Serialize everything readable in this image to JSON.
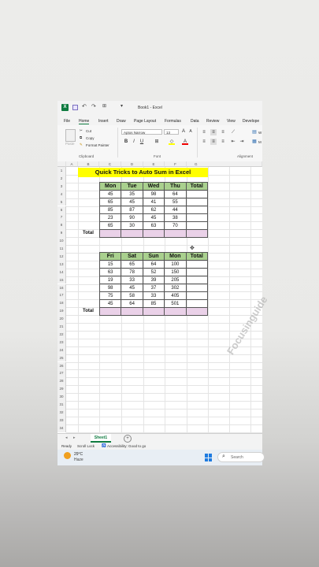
{
  "window": {
    "title": "Book1 - Excel",
    "undo_icon": "undo-icon",
    "redo_icon": "redo-icon",
    "save_icon": "save-icon"
  },
  "menu": [
    "File",
    "Home",
    "Insert",
    "Draw",
    "Page Layout",
    "Formulas",
    "Data",
    "Review",
    "View",
    "Develope"
  ],
  "ribbon": {
    "paste_label": "Paste",
    "cut_label": "Cut",
    "copy_label": "Copy",
    "format_painter_label": "Format Painter",
    "clipboard_group": "Clipboard",
    "font_name": "Aptos Narrow",
    "font_size": "13",
    "font_group": "Font",
    "alignment_group": "Alignment",
    "bold": "B",
    "italic": "I",
    "underline": "U",
    "wrap": "W",
    "merge": "M"
  },
  "columns": [
    "A",
    "B",
    "C",
    "D",
    "E",
    "F",
    "G"
  ],
  "rows": [
    "1",
    "2",
    "3",
    "4",
    "5",
    "6",
    "7",
    "8",
    "9",
    "10",
    "11",
    "12",
    "13",
    "14",
    "15",
    "16",
    "17",
    "18",
    "19",
    "20",
    "21",
    "22",
    "23",
    "24",
    "25",
    "26",
    "27",
    "28",
    "29",
    "30",
    "31",
    "32",
    "33",
    "34"
  ],
  "banner": "Quick Tricks to Auto Sum in Excel",
  "table1": {
    "headers": [
      "Mon",
      "Tue",
      "Wed",
      "Thu",
      "Total"
    ],
    "rows": [
      [
        "45",
        "35",
        "98",
        "64",
        ""
      ],
      [
        "65",
        "45",
        "41",
        "55",
        ""
      ],
      [
        "85",
        "87",
        "62",
        "44",
        ""
      ],
      [
        "23",
        "90",
        "45",
        "38",
        ""
      ],
      [
        "65",
        "30",
        "63",
        "70",
        ""
      ]
    ],
    "total_label": "Total"
  },
  "table2": {
    "headers": [
      "Fri",
      "Sat",
      "Sun",
      "Mon",
      "Total"
    ],
    "rows": [
      [
        "15",
        "65",
        "64",
        "100",
        ""
      ],
      [
        "63",
        "78",
        "52",
        "150",
        ""
      ],
      [
        "19",
        "33",
        "39",
        "205",
        ""
      ],
      [
        "98",
        "45",
        "37",
        "302",
        ""
      ],
      [
        "75",
        "58",
        "33",
        "405",
        ""
      ],
      [
        "45",
        "64",
        "85",
        "501",
        ""
      ]
    ],
    "total_label": "Total"
  },
  "sheet_tab": "Sheet1",
  "status": {
    "ready": "Ready",
    "scroll_lock": "Scroll Lock",
    "accessibility": "Accessibility: Good to go"
  },
  "taskbar": {
    "temp": "29°C",
    "weather": "Haze",
    "search_placeholder": "Search"
  },
  "watermark": "Focusinguide",
  "colors": {
    "header_green": "#a9d08e",
    "total_pink": "#ead1e8",
    "banner_yellow": "#ffff00",
    "excel_green": "#107c41"
  }
}
